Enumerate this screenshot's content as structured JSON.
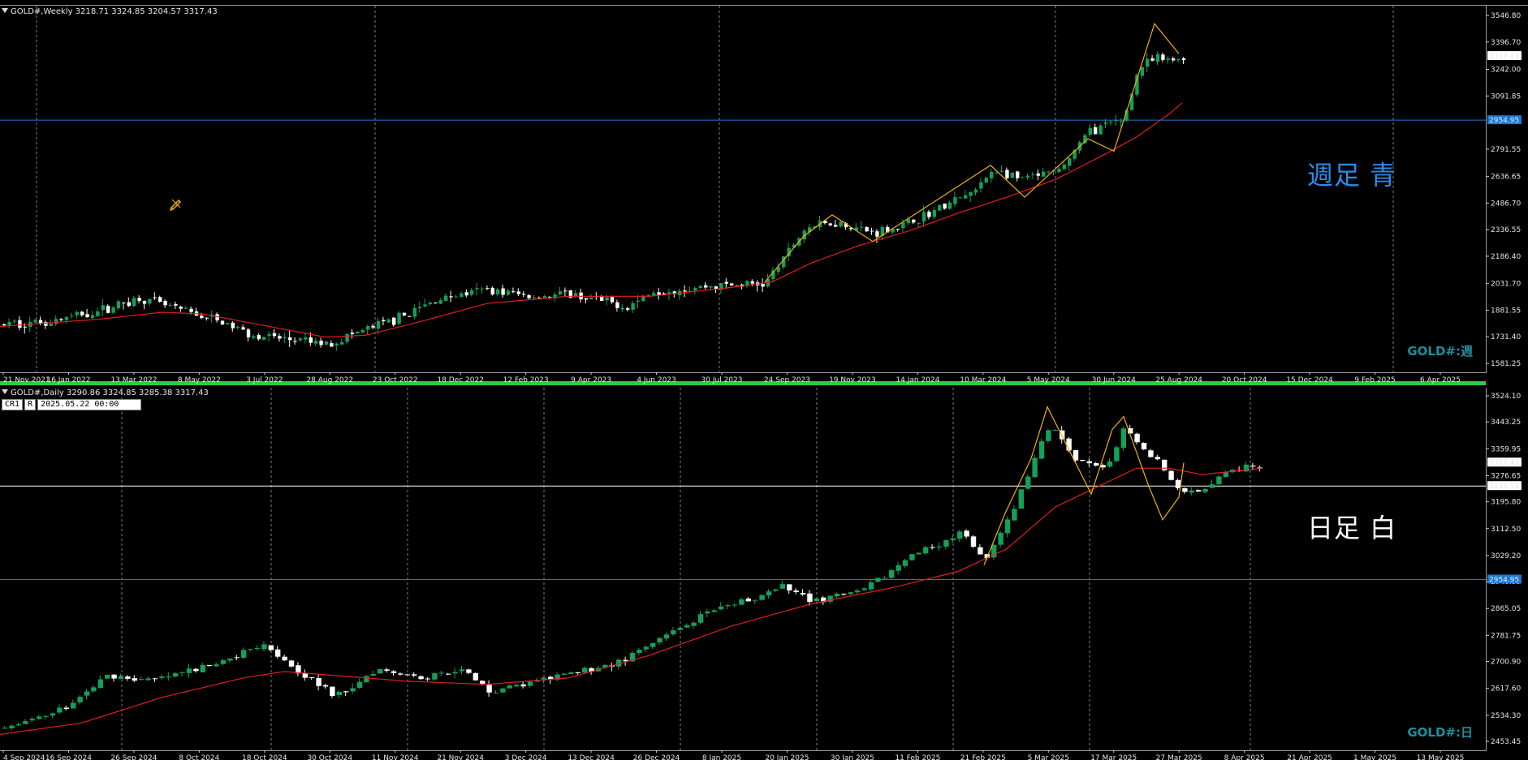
{
  "weekly": {
    "title": "GOLD#,Weekly",
    "ohlc": "3218.71 3324.85 3204.57 3317.43",
    "label": "週足 青",
    "label_color": "#2b8be8",
    "symbol_label": "GOLD#:週",
    "price_ticks": [
      "3546.80",
      "3396.70",
      "3242.00",
      "3091.85",
      "2791.55",
      "2636.65",
      "2486.70",
      "2336.55",
      "2186.40",
      "2031.70",
      "1881.55",
      "1731.40",
      "1581.25"
    ],
    "current_price": "3317.43",
    "hline_price": "2954.95",
    "date_ticks": [
      "21 Nov 2021",
      "16 Jan 2022",
      "13 Mar 2022",
      "8 May 2022",
      "3 Jul 2022",
      "28 Aug 2022",
      "23 Oct 2022",
      "18 Dec 2022",
      "12 Feb 2023",
      "9 Apr 2023",
      "4 Jun 2023",
      "30 Jul 2023",
      "24 Sep 2023",
      "19 Nov 2023",
      "14 Jan 2024",
      "10 Mar 2024",
      "5 May 2024",
      "30 Jun 2024",
      "25 Aug 2024",
      "20 Oct 2024",
      "15 Dec 2024",
      "9 Feb 2025",
      "6 Apr 2025"
    ]
  },
  "daily": {
    "title": "GOLD#,Daily",
    "ohlc": "3290.86 3324.85 3285.38 3317.43",
    "crosshair_tag": "CR1",
    "crosshair_mode": "R",
    "crosshair_time": "2025.05.22 00:00",
    "label": "日足 白",
    "label_color": "#ffffff",
    "symbol_label": "GOLD#:日",
    "price_ticks": [
      "3524.10",
      "3443.25",
      "3359.95",
      "3276.65",
      "3195.80",
      "3112.50",
      "3029.20",
      "2948.35",
      "2865.05",
      "2781.75",
      "2700.90",
      "2617.60",
      "2534.30",
      "2453.45"
    ],
    "current_price": "3317.43",
    "white_line_price": "3244.58",
    "hline_price": "2954.95",
    "date_ticks": [
      "4 Sep 2024",
      "16 Sep 2024",
      "26 Sep 2024",
      "8 Oct 2024",
      "18 Oct 2024",
      "30 Oct 2024",
      "11 Nov 2024",
      "21 Nov 2024",
      "3 Dec 2024",
      "13 Dec 2024",
      "26 Dec 2024",
      "8 Jan 2025",
      "20 Jan 2025",
      "30 Jan 2025",
      "11 Feb 2025",
      "21 Feb 2025",
      "5 Mar 2025",
      "17 Mar 2025",
      "27 Mar 2025",
      "8 Apr 2025",
      "21 Apr 2025",
      "1 May 2025",
      "13 May 2025"
    ]
  },
  "colors": {
    "bull": "#14a05a",
    "bear": "#ffffff",
    "ma": "#e21e1e",
    "zigzag": "#f0b400",
    "hline": "#1e78d2",
    "grid": "#c8c8c8"
  }
}
